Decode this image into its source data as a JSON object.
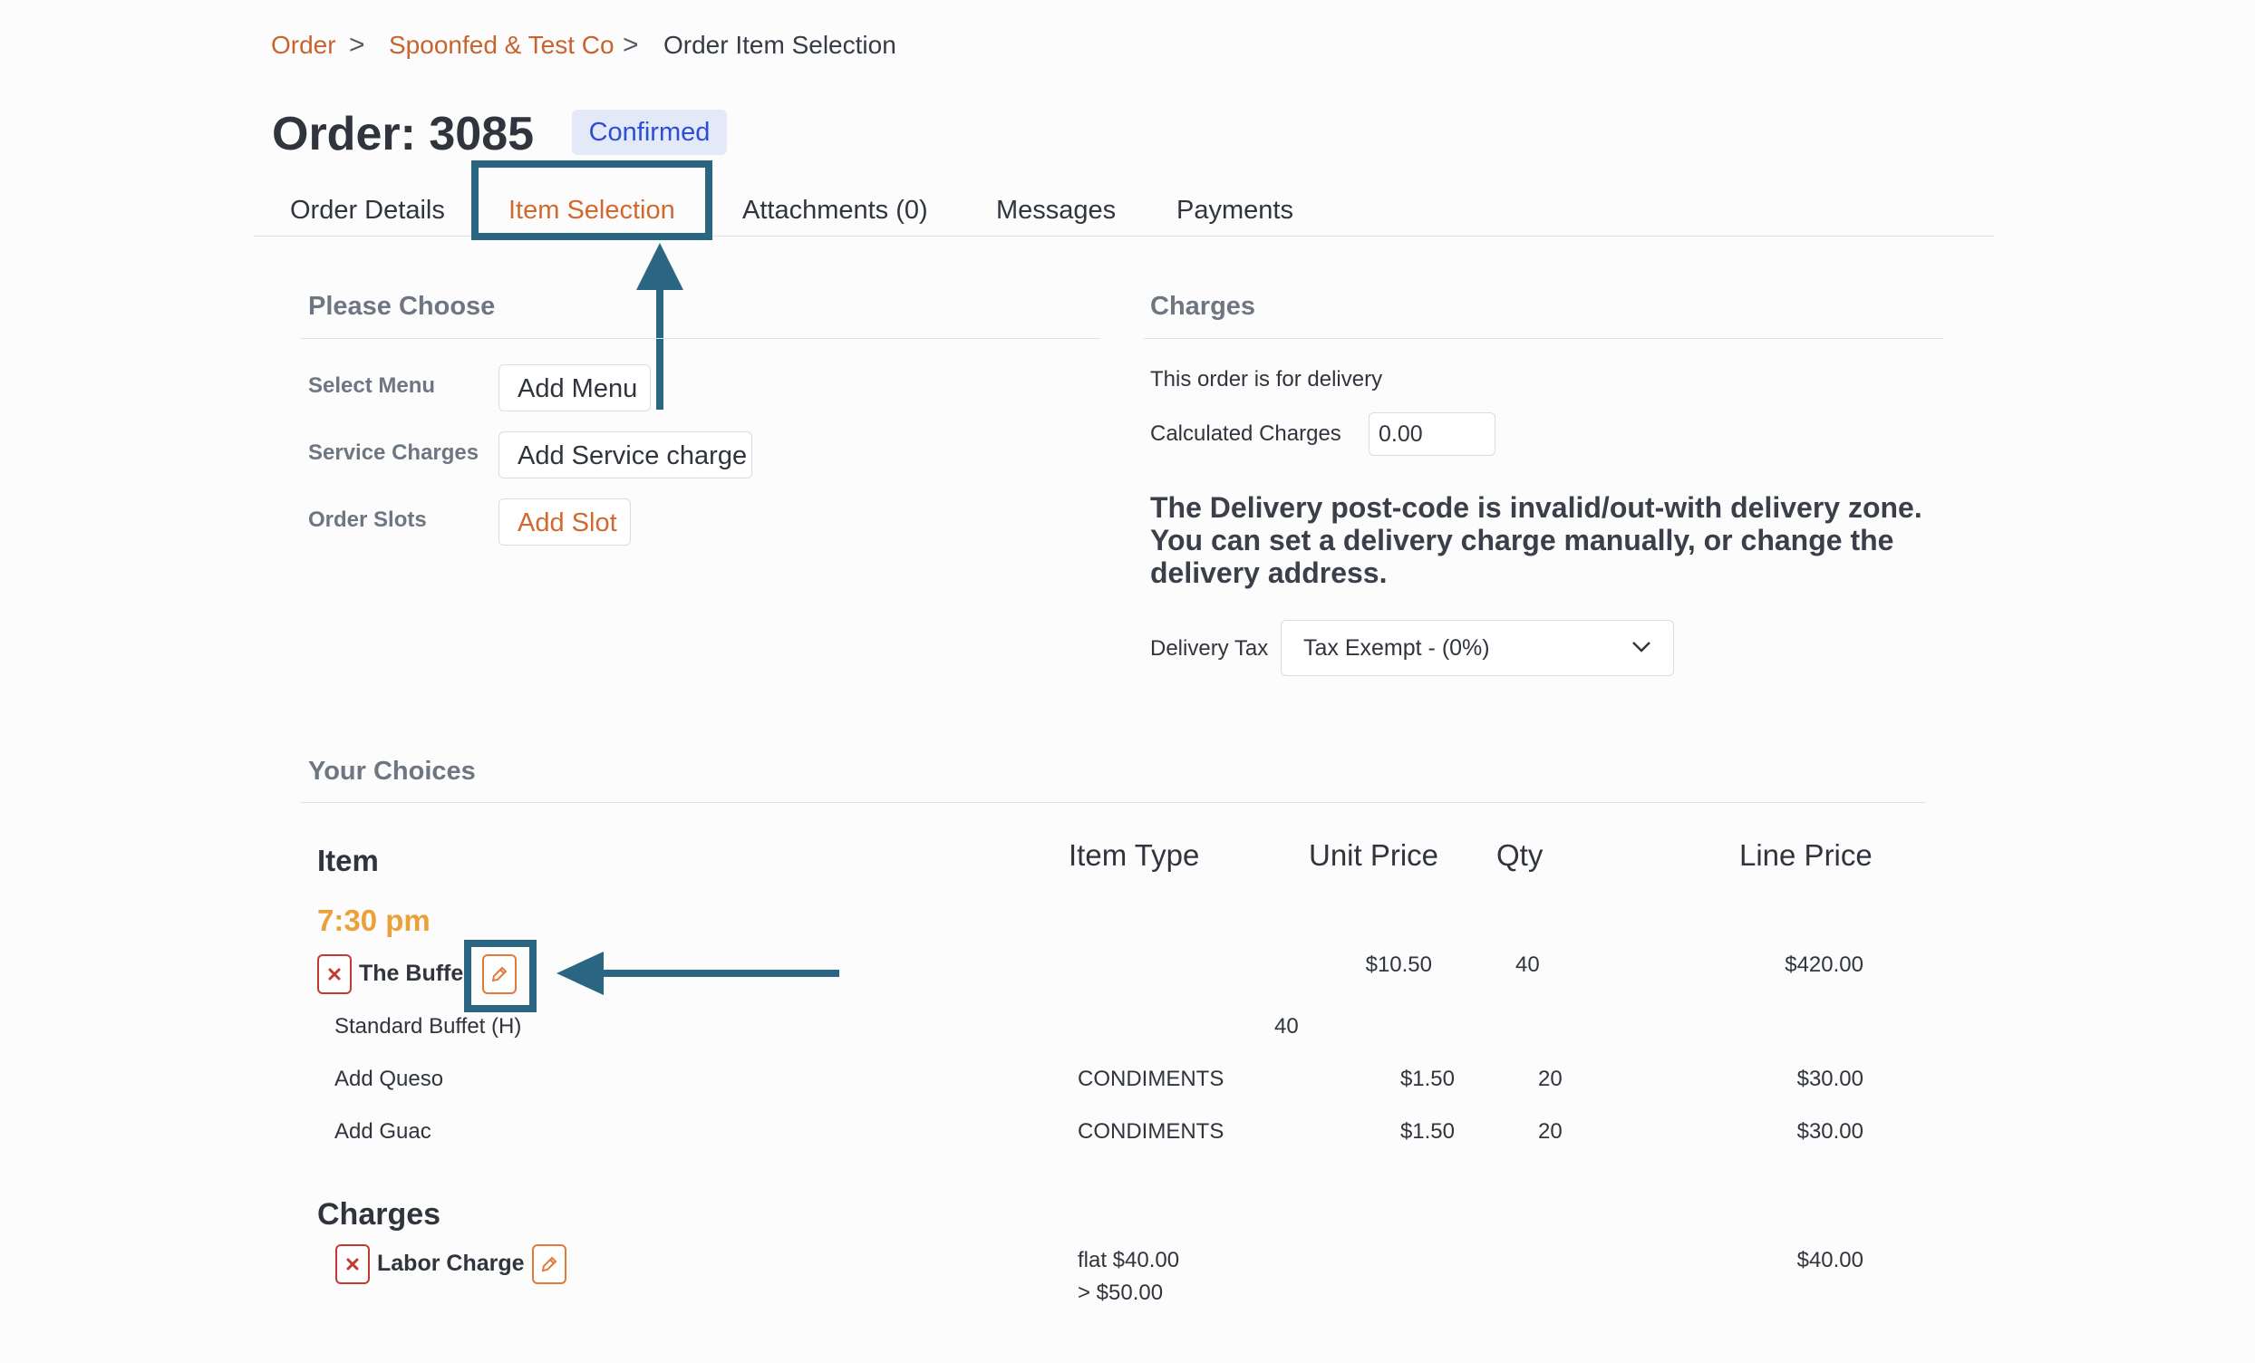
{
  "breadcrumb": {
    "items": [
      "Order",
      "Spoonfed & Test Co",
      "Order Item Selection"
    ],
    "separator": ">"
  },
  "order": {
    "title": "Order: 3085",
    "status": "Confirmed"
  },
  "tabs": [
    "Order Details",
    "Item Selection",
    "Attachments (0)",
    "Messages",
    "Payments"
  ],
  "active_tab": "Item Selection",
  "please_choose": {
    "title": "Please Choose",
    "rows": [
      {
        "label": "Select Menu",
        "button": "Add Menu"
      },
      {
        "label": "Service Charges",
        "button": "Add Service charge"
      },
      {
        "label": "Order Slots",
        "button": "Add Slot"
      }
    ]
  },
  "charges_panel": {
    "title": "Charges",
    "delivery_note": "This order is for delivery",
    "calculated_label": "Calculated Charges",
    "calculated_value": "0.00",
    "warning": "The Delivery post-code is invalid/out-with delivery zone. You can set a delivery charge manually, or change the delivery address.",
    "tax_label": "Delivery Tax",
    "tax_value": "Tax Exempt - (0%)"
  },
  "choices": {
    "title": "Your Choices",
    "headers": {
      "item": "Item",
      "item_type": "Item Type",
      "unit_price": "Unit Price",
      "qty": "Qty",
      "line_price": "Line Price"
    },
    "time_slot": "7:30 pm",
    "menu": {
      "name": "The Buffe",
      "unit_price": "$10.50",
      "qty": "40",
      "line_price": "$420.00"
    },
    "sub_items": [
      {
        "name": "Standard Buffet (H)",
        "type": "",
        "unit_price": "",
        "qty": "40",
        "line_price": ""
      },
      {
        "name": "Add Queso",
        "type": "CONDIMENTS",
        "unit_price": "$1.50",
        "qty": "20",
        "line_price": "$30.00"
      },
      {
        "name": "Add Guac",
        "type": "CONDIMENTS",
        "unit_price": "$1.50",
        "qty": "20",
        "line_price": "$30.00"
      }
    ],
    "charges_title": "Charges",
    "charges": [
      {
        "name": "Labor Charge",
        "detail_1": "flat $40.00",
        "detail_2": "> $50.00",
        "line_price": "$40.00"
      }
    ]
  },
  "colors": {
    "accent": "#d1692f",
    "highlight": "#2a6582",
    "time": "#eba13a",
    "badge_bg": "#e3e9f7",
    "badge_text": "#2a4fd6",
    "remove": "#c23a32"
  },
  "icons": [
    "chevron-right-icon",
    "chevron-down-icon",
    "remove-icon",
    "pencil-icon",
    "arrow-up-icon",
    "arrow-left-icon"
  ]
}
